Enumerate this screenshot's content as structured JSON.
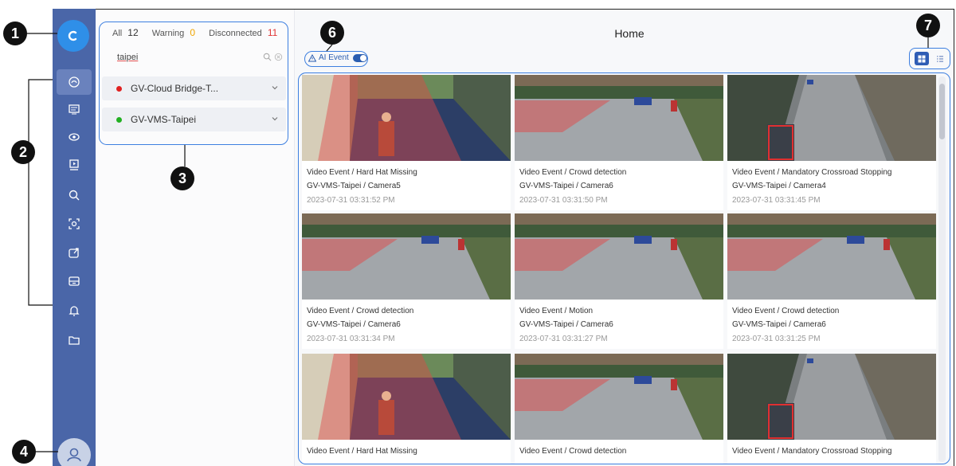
{
  "callouts": [
    "1",
    "2",
    "3",
    "4",
    "6",
    "7"
  ],
  "sidebar": {
    "icons": [
      "home-icon",
      "dashboard-icon",
      "view-icon",
      "playback-icon",
      "search-icon",
      "ai-scan-icon",
      "export-icon",
      "archive-icon",
      "bell-icon",
      "folder-icon"
    ],
    "active_index": 0
  },
  "panel": {
    "counts": {
      "all_label": "All",
      "all_value": "12",
      "warning_label": "Warning",
      "warning_value": "0",
      "disconnected_label": "Disconnected",
      "disconnected_value": "11"
    },
    "search": {
      "value": "taipei"
    },
    "devices": [
      {
        "name": "GV-Cloud Bridge-T...",
        "status_color": "#e02020"
      },
      {
        "name": "GV-VMS-Taipei",
        "status_color": "#22b022"
      }
    ]
  },
  "header": {
    "title": "Home",
    "ai_event_label": "AI Event",
    "ai_event_enabled": true,
    "view_modes": [
      "grid-view",
      "list-view"
    ],
    "active_view": "grid-view"
  },
  "events": [
    {
      "title": "Video Event / Hard Hat Missing",
      "source": "GV-VMS-Taipei / Camera5",
      "time": "2023-07-31 03:31:52 PM",
      "scene": "lobby"
    },
    {
      "title": "Video Event / Crowd detection",
      "source": "GV-VMS-Taipei / Camera6",
      "time": "2023-07-31 03:31:50 PM",
      "scene": "street"
    },
    {
      "title": "Video Event / Mandatory Crossroad Stopping",
      "source": "GV-VMS-Taipei / Camera4",
      "time": "2023-07-31 03:31:45 PM",
      "scene": "road"
    },
    {
      "title": "Video Event / Crowd detection",
      "source": "GV-VMS-Taipei / Camera6",
      "time": "2023-07-31 03:31:34 PM",
      "scene": "street"
    },
    {
      "title": "Video Event / Motion",
      "source": "GV-VMS-Taipei / Camera6",
      "time": "2023-07-31 03:31:27 PM",
      "scene": "street"
    },
    {
      "title": "Video Event / Crowd detection",
      "source": "GV-VMS-Taipei / Camera6",
      "time": "2023-07-31 03:31:25 PM",
      "scene": "street"
    },
    {
      "title": "Video Event / Hard Hat Missing",
      "source": "",
      "time": "",
      "scene": "lobby"
    },
    {
      "title": "Video Event / Crowd detection",
      "source": "",
      "time": "",
      "scene": "street"
    },
    {
      "title": "Video Event / Mandatory Crossroad Stopping",
      "source": "",
      "time": "",
      "scene": "road"
    }
  ]
}
